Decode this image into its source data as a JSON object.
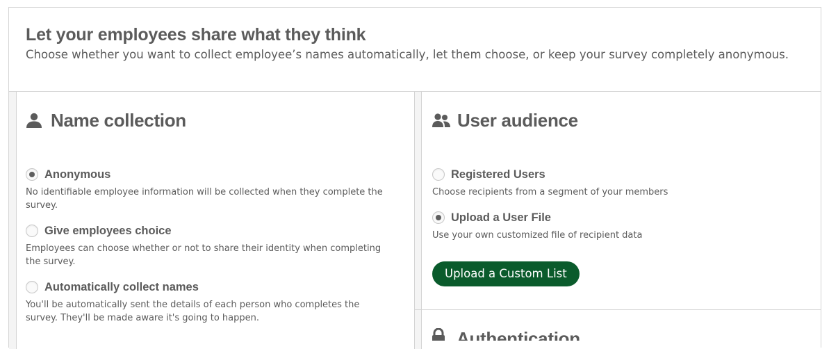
{
  "header": {
    "title": "Let your employees share what they think",
    "description": "Choose whether you want to collect employee’s names automatically, let them choose, or keep your survey completely anonymous."
  },
  "name_collection": {
    "title": "Name collection",
    "icon": "user-icon",
    "options": [
      {
        "label": "Anonymous",
        "checked": true,
        "description": "No identifiable employee information will be collected when they complete the survey."
      },
      {
        "label": "Give employees choice",
        "checked": false,
        "description": "Employees can choose whether or not to share their identity when completing the survey."
      },
      {
        "label": "Automatically collect names",
        "checked": false,
        "description": "You'll be automatically sent the details of each person who completes the survey. They'll be made aware it's going to happen."
      }
    ]
  },
  "user_audience": {
    "title": "User audience",
    "icon": "users-icon",
    "options": [
      {
        "label": "Registered Users",
        "checked": false,
        "description": "Choose recipients from a segment of your members"
      },
      {
        "label": "Upload a User File",
        "checked": true,
        "description": "Use your own customized file of recipient data"
      }
    ],
    "upload_button_label": "Upload a Custom List"
  },
  "authentication": {
    "title": "Authentication",
    "icon": "lock-icon"
  },
  "colors": {
    "primary_button": "#0a5b2c",
    "text": "#5b5b5b",
    "border": "#d4d4d4"
  }
}
